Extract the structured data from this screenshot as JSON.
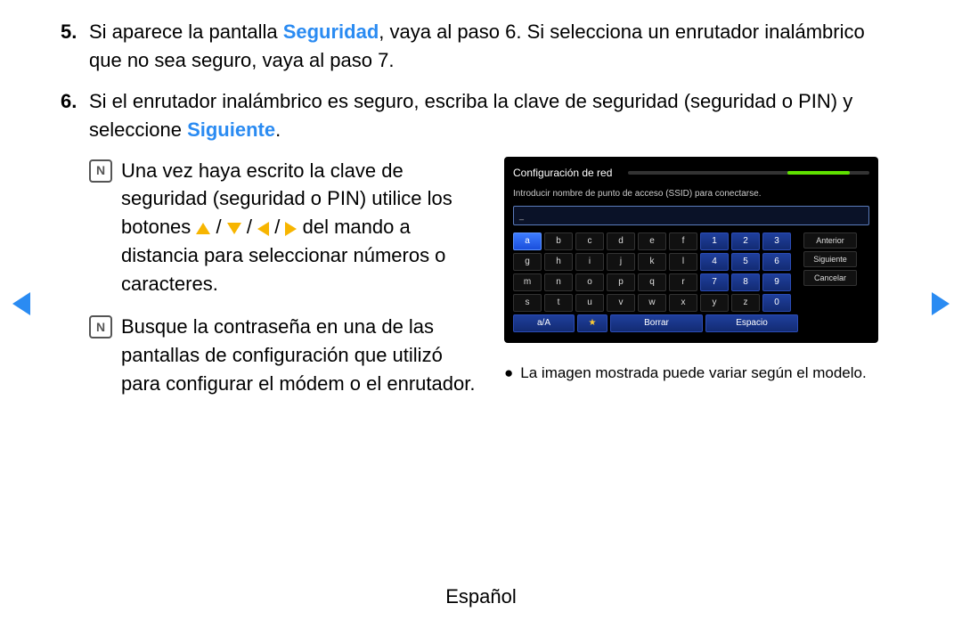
{
  "steps": {
    "five": {
      "num": "5.",
      "pre": " Si aparece la pantalla ",
      "highlight": "Seguridad",
      "post": ", vaya al paso 6. Si selecciona un enrutador inalámbrico que no sea seguro, vaya al paso 7."
    },
    "six": {
      "num": "6.",
      "pre": " Si el enrutador inalámbrico es seguro, escriba la clave de seguridad (seguridad o PIN) y seleccione ",
      "highlight": "Siguiente",
      "post": "."
    }
  },
  "notes": {
    "icon": "N",
    "n1": {
      "pre": "Una vez haya escrito la clave de seguridad (seguridad o PIN) utilice los botones ",
      "slash": " / ",
      "post": " del mando a distancia para seleccionar números o caracteres."
    },
    "n2": "Busque la contraseña en una de las pantallas de configuración que utilizó para configurar el módem o el enrutador."
  },
  "tv": {
    "title": "Configuración de red",
    "instruction": "Introducir nombre de punto de acceso (SSID) para conectarse.",
    "inputPlaceholder": "_",
    "keys": [
      [
        "a",
        "b",
        "c",
        "d",
        "e",
        "f",
        "1",
        "2",
        "3"
      ],
      [
        "g",
        "h",
        "i",
        "j",
        "k",
        "l",
        "4",
        "5",
        "6"
      ],
      [
        "m",
        "n",
        "o",
        "p",
        "q",
        "r",
        "7",
        "8",
        "9"
      ],
      [
        "s",
        "t",
        "u",
        "v",
        "w",
        "x",
        "y",
        "z",
        "0"
      ]
    ],
    "side": {
      "prev": "Anterior",
      "next": "Siguiente",
      "cancel": "Cancelar"
    },
    "bottom": {
      "shift": "a/A",
      "star": "★",
      "del": "Borrar",
      "space": "Espacio"
    }
  },
  "caption": "La imagen mostrada puede variar según el modelo.",
  "captionBullet": "●",
  "footer": "Español"
}
